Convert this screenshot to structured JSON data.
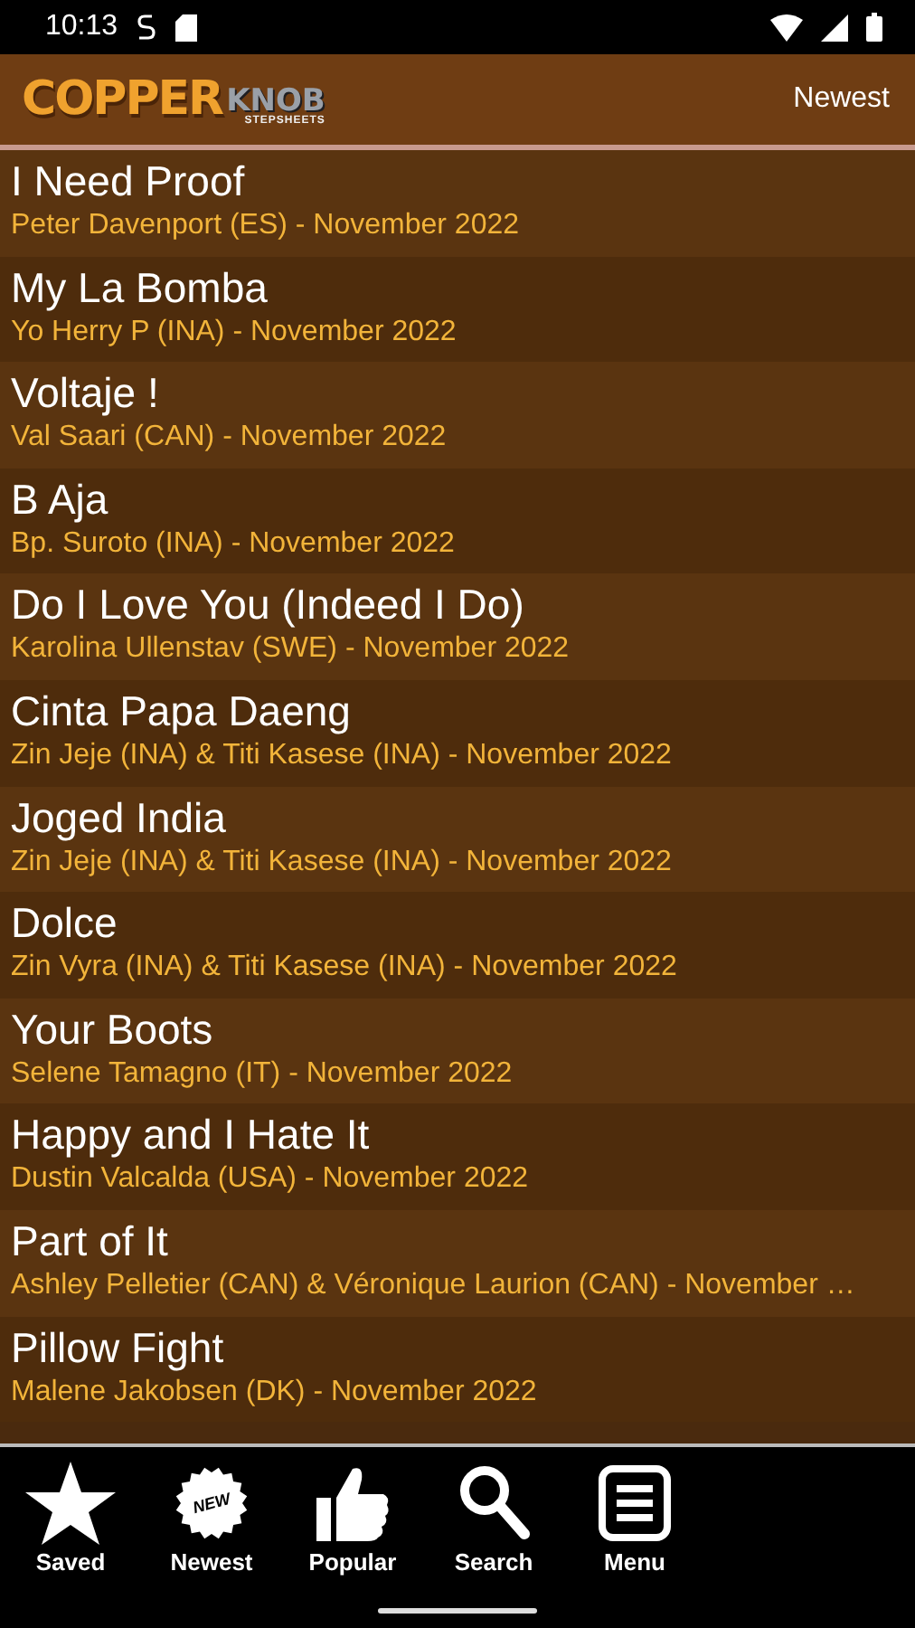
{
  "status_bar": {
    "time": "10:13"
  },
  "header": {
    "logo": {
      "word_1": "COPPER",
      "word_2": "KNOB",
      "tagline": "STEPSHEETS"
    },
    "sort_label": "Newest"
  },
  "dances": [
    {
      "title": "I Need Proof",
      "byline": "Peter Davenport (ES) - November 2022"
    },
    {
      "title": "My La Bomba",
      "byline": "Yo Herry P (INA) - November 2022"
    },
    {
      "title": "Voltaje !",
      "byline": "Val Saari (CAN) - November 2022"
    },
    {
      "title": "B Aja",
      "byline": "Bp. Suroto (INA) - November 2022"
    },
    {
      "title": "Do I Love You (Indeed I Do)",
      "byline": "Karolina Ullenstav (SWE) - November 2022"
    },
    {
      "title": "Cinta Papa Daeng",
      "byline": "Zin Jeje (INA) & Titi Kasese (INA) - November 2022"
    },
    {
      "title": "Joged India",
      "byline": "Zin Jeje (INA) & Titi Kasese (INA) - November 2022"
    },
    {
      "title": "Dolce",
      "byline": "Zin Vyra (INA) & Titi Kasese (INA) - November 2022"
    },
    {
      "title": "Your Boots",
      "byline": "Selene Tamagno (IT) - November 2022"
    },
    {
      "title": "Happy and I Hate It",
      "byline": "Dustin Valcalda (USA) - November 2022"
    },
    {
      "title": "Part of It",
      "byline": "Ashley Pelletier (CAN) & Véronique Laurion (CAN) - November …"
    },
    {
      "title": "Pillow Fight",
      "byline": "Malene Jakobsen (DK) - November 2022"
    }
  ],
  "nav": [
    {
      "kind": "star",
      "label": "Saved"
    },
    {
      "kind": "new",
      "label": "Newest",
      "badge": "NEW"
    },
    {
      "kind": "thumb",
      "label": "Popular"
    },
    {
      "kind": "search",
      "label": "Search"
    },
    {
      "kind": "menu",
      "label": "Menu"
    }
  ]
}
